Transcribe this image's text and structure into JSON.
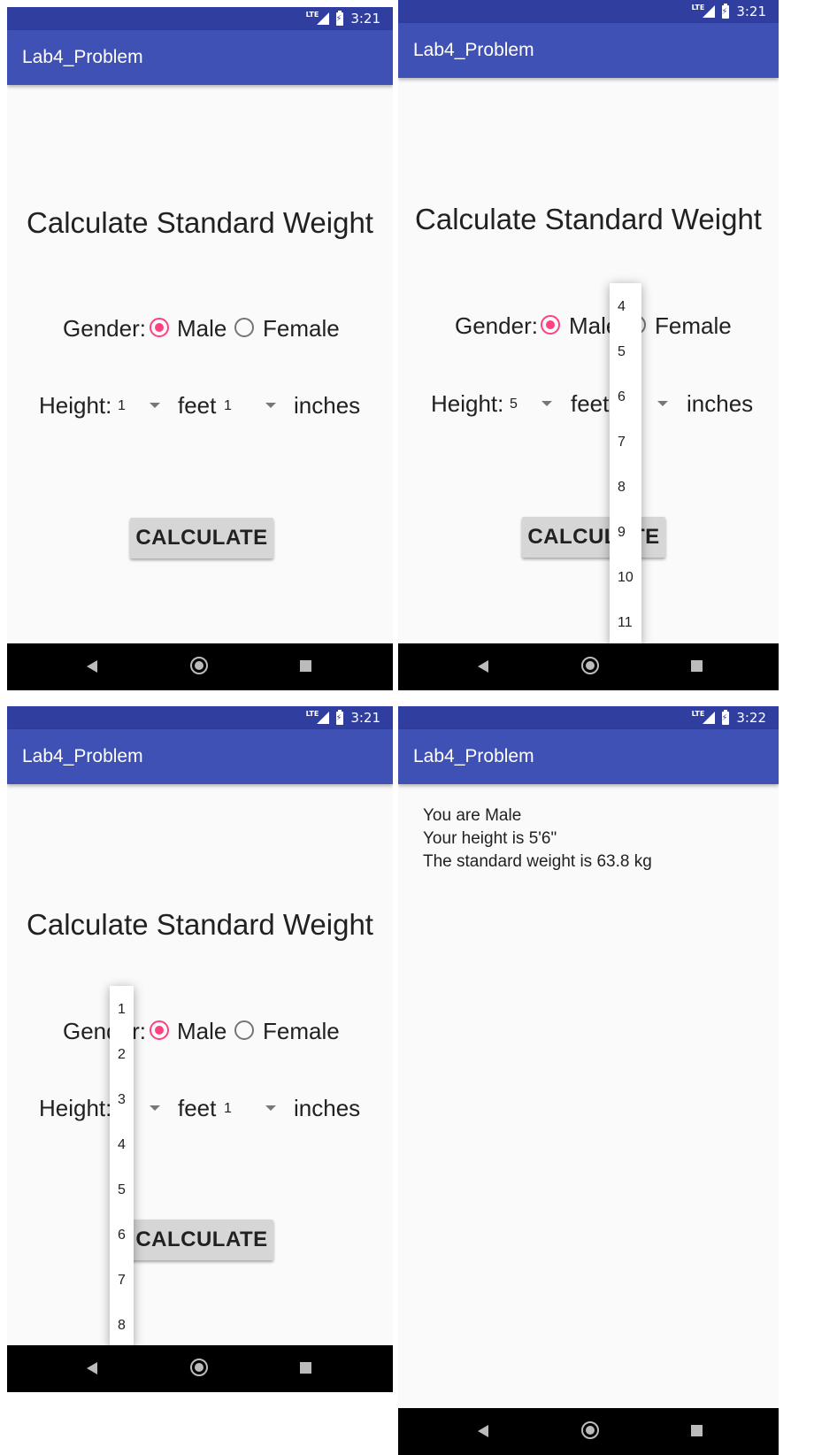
{
  "status": {
    "time_a": "3:21",
    "time_b": "3:22",
    "network": "LTE"
  },
  "app": {
    "title": "Lab4_Problem"
  },
  "form": {
    "heading": "Calculate Standard Weight",
    "gender_label": "Gender:",
    "male": "Male",
    "female": "Female",
    "height_label": "Height:",
    "feet": "feet",
    "inches": "inches",
    "calculate": "CALCULATE"
  },
  "screens": {
    "s1": {
      "feet_value": "1",
      "inches_value": "1"
    },
    "s2": {
      "feet_value": "5",
      "inches_options": [
        "4",
        "5",
        "6",
        "7",
        "8",
        "9",
        "10",
        "11"
      ]
    },
    "s3": {
      "inches_value": "1",
      "feet_options": [
        "1",
        "2",
        "3",
        "4",
        "5",
        "6",
        "7",
        "8"
      ]
    },
    "s4": {
      "line1": "You are Male",
      "line2": "Your height is 5'6\"",
      "line3": "The standard weight is 63.8 kg"
    }
  }
}
